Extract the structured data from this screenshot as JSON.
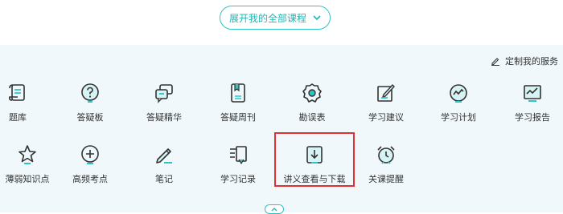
{
  "header": {
    "expand_label": "展开我的全部课程"
  },
  "panel": {
    "customize_label": "定制我的服务",
    "row1": [
      {
        "label": "题库",
        "icon": "scroll-icon"
      },
      {
        "label": "答疑板",
        "icon": "question-icon"
      },
      {
        "label": "答疑精华",
        "icon": "chat-icon"
      },
      {
        "label": "答疑周刊",
        "icon": "book-icon"
      },
      {
        "label": "勘误表",
        "icon": "gear-icon"
      },
      {
        "label": "学习建议",
        "icon": "edit-icon"
      },
      {
        "label": "学习计划",
        "icon": "pulse-icon"
      },
      {
        "label": "学习报告",
        "icon": "report-icon"
      }
    ],
    "row2": [
      {
        "label": "薄弱知识点",
        "icon": "star-icon"
      },
      {
        "label": "高频考点",
        "icon": "plus-circle-icon"
      },
      {
        "label": "笔记",
        "icon": "pencil-icon"
      },
      {
        "label": "学习记录",
        "icon": "list-icon"
      },
      {
        "label": "讲义查看与下载",
        "icon": "download-icon"
      },
      {
        "label": "关课提醒",
        "icon": "alarm-icon"
      }
    ]
  },
  "colors": {
    "accent": "#2ec4c4",
    "highlight": "#e03030",
    "panel_bg": "#f0f8fb"
  }
}
